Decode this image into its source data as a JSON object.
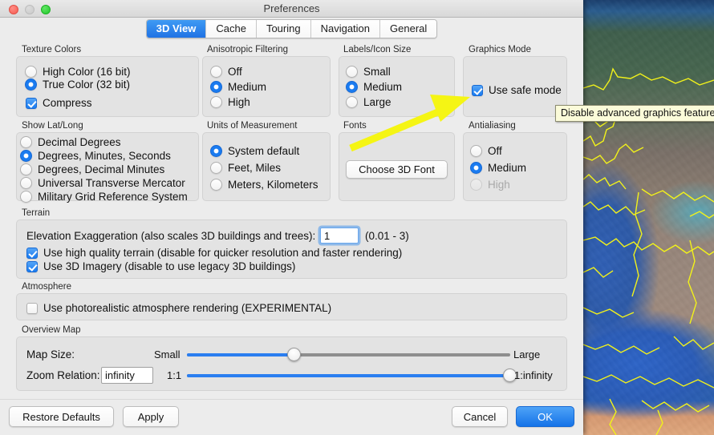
{
  "window": {
    "title": "Preferences",
    "controls": {
      "close": "close-button",
      "minimize": "minimize-button",
      "zoom": "zoom-button"
    }
  },
  "tabs": [
    {
      "label": "3D View",
      "active": true
    },
    {
      "label": "Cache",
      "active": false
    },
    {
      "label": "Touring",
      "active": false
    },
    {
      "label": "Navigation",
      "active": false
    },
    {
      "label": "General",
      "active": false
    }
  ],
  "groups": {
    "texture_colors": {
      "label": "Texture Colors",
      "radios": [
        {
          "label": "High Color (16 bit)",
          "selected": false
        },
        {
          "label": "True Color (32 bit)",
          "selected": true
        }
      ],
      "checkbox": {
        "label": "Compress",
        "checked": true
      }
    },
    "show_lat_long": {
      "label": "Show Lat/Long",
      "radios": [
        {
          "label": "Decimal Degrees",
          "selected": false
        },
        {
          "label": "Degrees, Minutes, Seconds",
          "selected": true
        },
        {
          "label": "Degrees, Decimal Minutes",
          "selected": false
        },
        {
          "label": "Universal Transverse Mercator",
          "selected": false
        },
        {
          "label": "Military Grid Reference System",
          "selected": false
        }
      ]
    },
    "anisotropic_filtering": {
      "label": "Anisotropic Filtering",
      "radios": [
        {
          "label": "Off",
          "selected": false
        },
        {
          "label": "Medium",
          "selected": true
        },
        {
          "label": "High",
          "selected": false
        }
      ]
    },
    "units_of_measurement": {
      "label": "Units of Measurement",
      "radios": [
        {
          "label": "System default",
          "selected": true
        },
        {
          "label": "Feet, Miles",
          "selected": false
        },
        {
          "label": "Meters, Kilometers",
          "selected": false
        }
      ]
    },
    "labels_icon_size": {
      "label": "Labels/Icon Size",
      "radios": [
        {
          "label": "Small",
          "selected": false
        },
        {
          "label": "Medium",
          "selected": true
        },
        {
          "label": "Large",
          "selected": false
        }
      ]
    },
    "fonts": {
      "label": "Fonts",
      "button": "Choose 3D Font"
    },
    "graphics_mode": {
      "label": "Graphics Mode",
      "checkbox": {
        "label": "Use safe mode",
        "checked": true
      }
    },
    "antialiasing": {
      "label": "Antialiasing",
      "radios": [
        {
          "label": "Off",
          "selected": false,
          "disabled": false
        },
        {
          "label": "Medium",
          "selected": true,
          "disabled": false
        },
        {
          "label": "High",
          "selected": false,
          "disabled": true
        }
      ]
    },
    "terrain": {
      "label": "Terrain",
      "elevation_label": "Elevation Exaggeration (also scales 3D buildings and trees):",
      "elevation_value": "1",
      "elevation_range": "(0.01 - 3)",
      "checkboxes": [
        {
          "label": "Use high quality terrain (disable for quicker resolution and faster rendering)",
          "checked": true
        },
        {
          "label": "Use 3D Imagery (disable to use legacy 3D buildings)",
          "checked": true
        }
      ]
    },
    "atmosphere": {
      "label": "Atmosphere",
      "checkbox": {
        "label": "Use photorealistic atmosphere rendering (EXPERIMENTAL)",
        "checked": false
      }
    },
    "overview_map": {
      "label": "Overview Map",
      "map_size": {
        "label": "Map Size:",
        "min_label": "Small",
        "max_label": "Large",
        "value_percent": 33
      },
      "zoom_relation": {
        "label": "Zoom Relation:",
        "value": "infinity",
        "min_label": "1:1",
        "max_label": "1:infinity",
        "value_percent": 100
      }
    }
  },
  "tooltip": {
    "text": "Disable advanced graphics features"
  },
  "footer": {
    "restore_defaults": "Restore Defaults",
    "apply": "Apply",
    "cancel": "Cancel",
    "ok": "OK"
  },
  "annotation": {
    "type": "arrow",
    "color": "#f5f514",
    "points": "from (436,184) to (588,121)"
  },
  "colors": {
    "accent_blue": "#1a7bf0",
    "window_bg": "#ececec",
    "group_bg": "#e3e3e3",
    "tooltip_bg": "#fbfbd9",
    "annotation_yellow": "#f5f514"
  }
}
